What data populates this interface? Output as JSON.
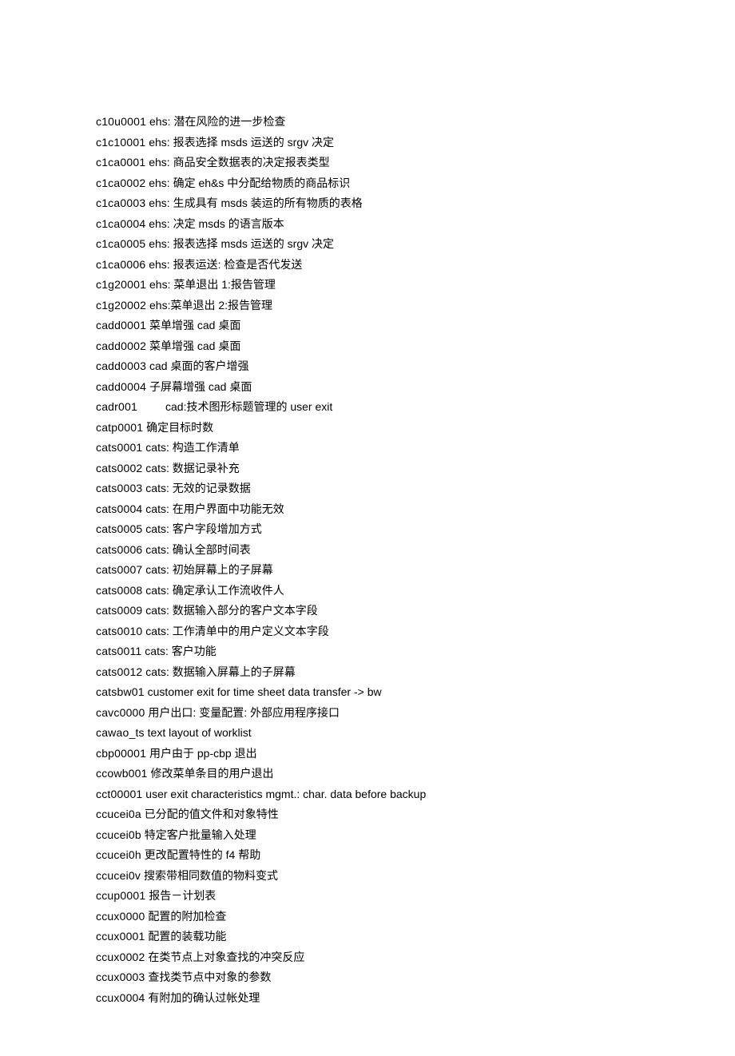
{
  "lines": [
    {
      "code": "c10u0001",
      "desc": " ehs: 潜在风险的进一步检查"
    },
    {
      "code": "c1c10001",
      "desc": " ehs: 报表选择 msds 运送的 srgv 决定"
    },
    {
      "code": "c1ca0001",
      "desc": " ehs: 商品安全数据表的决定报表类型"
    },
    {
      "code": "c1ca0002",
      "desc": " ehs: 确定 eh&s 中分配给物质的商品标识"
    },
    {
      "code": "c1ca0003",
      "desc": " ehs: 生成具有 msds 装运的所有物质的表格"
    },
    {
      "code": "c1ca0004",
      "desc": " ehs: 决定 msds 的语言版本"
    },
    {
      "code": "c1ca0005",
      "desc": " ehs: 报表选择 msds 运送的 srgv 决定"
    },
    {
      "code": "c1ca0006",
      "desc": " ehs: 报表运送: 检查是否代发送"
    },
    {
      "code": "c1g20001",
      "desc": " ehs: 菜单退出 1:报告管理"
    },
    {
      "code": "c1g20002",
      "desc": " ehs:菜单退出 2:报告管理"
    },
    {
      "code": "cadd0001",
      "desc": " 菜单增强 cad 桌面"
    },
    {
      "code": "cadd0002",
      "desc": " 菜单增强 cad 桌面"
    },
    {
      "code": "cadd0003",
      "desc": " cad 桌面的客户增强"
    },
    {
      "code": "cadd0004",
      "desc": " 子屏幕增强 cad 桌面"
    },
    {
      "code": "cadr001",
      "desc": "         cad:技术图形标题管理的 user exit"
    },
    {
      "code": "catp0001",
      "desc": " 确定目标时数"
    },
    {
      "code": "cats0001",
      "desc": " cats: 构造工作清单"
    },
    {
      "code": "cats0002",
      "desc": " cats: 数据记录补充"
    },
    {
      "code": "cats0003",
      "desc": " cats: 无效的记录数据"
    },
    {
      "code": "cats0004",
      "desc": " cats: 在用户界面中功能无效"
    },
    {
      "code": "cats0005",
      "desc": " cats: 客户字段增加方式"
    },
    {
      "code": "cats0006",
      "desc": " cats: 确认全部时间表"
    },
    {
      "code": "cats0007",
      "desc": " cats: 初始屏幕上的子屏幕"
    },
    {
      "code": "cats0008",
      "desc": " cats: 确定承认工作流收件人"
    },
    {
      "code": "cats0009",
      "desc": " cats: 数据输入部分的客户文本字段"
    },
    {
      "code": "cats0010",
      "desc": " cats: 工作清单中的用户定义文本字段"
    },
    {
      "code": "cats0011",
      "desc": " cats: 客户功能"
    },
    {
      "code": "cats0012",
      "desc": " cats: 数据输入屏幕上的子屏幕"
    },
    {
      "code": "catsbw01",
      "desc": " customer exit for time sheet data transfer -> bw"
    },
    {
      "code": "cavc0000",
      "desc": " 用户出口: 变量配置: 外部应用程序接口"
    },
    {
      "code": "cawao_ts",
      "desc": " text layout of worklist"
    },
    {
      "code": "cbp00001",
      "desc": " 用户由于 pp-cbp 退出"
    },
    {
      "code": "ccowb001",
      "desc": " 修改菜单条目的用户退出"
    },
    {
      "code": "cct00001",
      "desc": " user exit characteristics mgmt.: char. data before backup"
    },
    {
      "code": "ccucei0a",
      "desc": " 已分配的值文件和对象特性"
    },
    {
      "code": "ccucei0b",
      "desc": " 特定客户批量输入处理"
    },
    {
      "code": "ccucei0h",
      "desc": " 更改配置特性的 f4 帮助"
    },
    {
      "code": "ccucei0v",
      "desc": " 搜索带相同数值的物料变式"
    },
    {
      "code": "ccup0001",
      "desc": " 报告－计划表"
    },
    {
      "code": "ccux0000",
      "desc": " 配置的附加检查"
    },
    {
      "code": "ccux0001",
      "desc": " 配置的装载功能"
    },
    {
      "code": "ccux0002",
      "desc": " 在类节点上对象查找的冲突反应"
    },
    {
      "code": "ccux0003",
      "desc": " 查找类节点中对象的参数"
    },
    {
      "code": "ccux0004",
      "desc": " 有附加的确认过帐处理"
    }
  ]
}
